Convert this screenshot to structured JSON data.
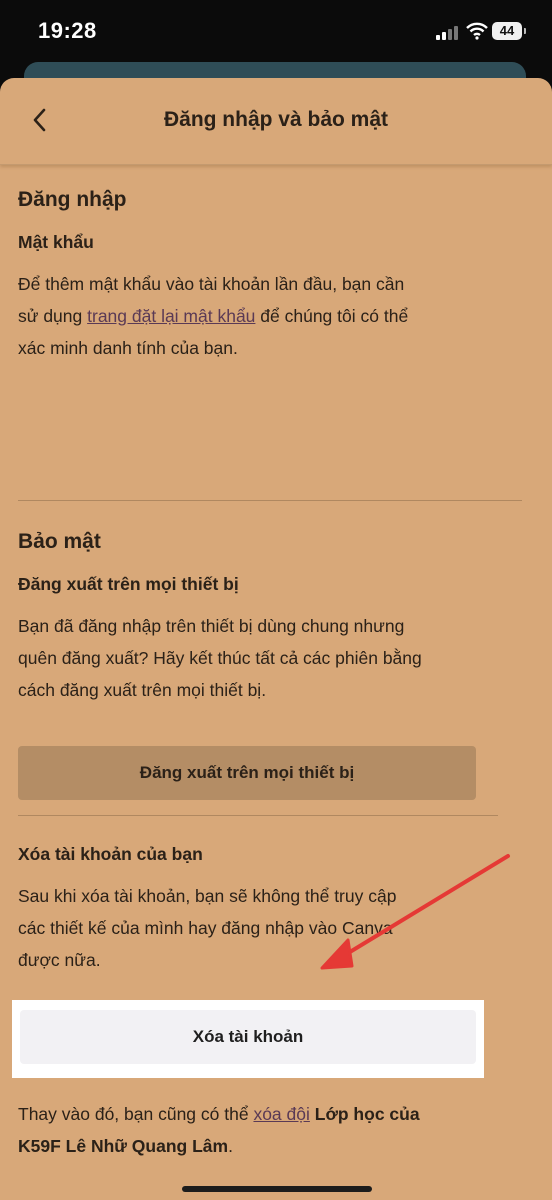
{
  "status_bar": {
    "time": "19:28",
    "battery": "44"
  },
  "header": {
    "title": "Đăng nhập và bảo mật"
  },
  "login": {
    "section_title": "Đăng nhập",
    "password_title": "Mật khẩu",
    "password_text_1": "Để thêm mật khẩu vào tài khoản lần đầu, bạn cần",
    "password_text_2a": "sử dụng ",
    "password_link": "trang đặt lại mật khẩu",
    "password_text_2b": " để chúng tôi có thể",
    "password_text_3": "xác minh danh tính của bạn."
  },
  "security": {
    "section_title": "Bảo mật",
    "logout_title": "Đăng xuất trên mọi thiết bị",
    "logout_text_1": "Bạn đã đăng nhập trên thiết bị dùng chung nhưng",
    "logout_text_2": "quên đăng xuất? Hãy kết thúc tất cả các phiên bằng",
    "logout_text_3": "cách đăng xuất trên mọi thiết bị.",
    "logout_button": "Đăng xuất trên mọi thiết bị"
  },
  "delete_account": {
    "title": "Xóa tài khoản của bạn",
    "text_1": "Sau khi xóa tài khoản, bạn sẽ không thể truy cập",
    "text_2": "các thiết kế của mình hay đăng nhập vào Canva",
    "text_3": "được nữa.",
    "button": "Xóa tài khoản",
    "alt_text_1": "Thay vào đó, bạn cũng có thể ",
    "alt_link": "xóa đội",
    "alt_team_1": " Lớp học của",
    "alt_team_2": "K59F Lê Nhữ Quang Lâm",
    "alt_end": "."
  },
  "colors": {
    "sheet_bg": "#d8a879",
    "button_bg": "#b48d65",
    "highlight_bg": "#ffffff",
    "arrow": "#e53935",
    "link": "#5a3a55"
  }
}
